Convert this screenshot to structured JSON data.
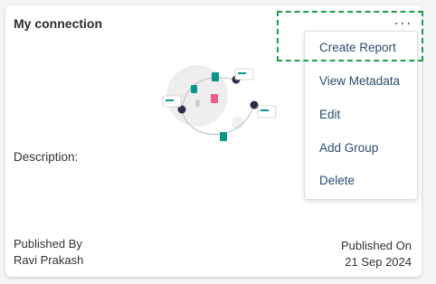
{
  "card": {
    "title": "My connection",
    "more_label": "...",
    "description_label": "Description:",
    "published_by_label": "Published By",
    "published_by_value": "Ravi Prakash",
    "published_on_label": "Published On",
    "published_on_value": "21 Sep 2024"
  },
  "menu": {
    "items": [
      "Create Report",
      "View Metadata",
      "Edit",
      "Add Group",
      "Delete"
    ]
  },
  "colors": {
    "menu_text": "#2b4c6e",
    "highlight": "#1ea04a",
    "accent_teal": "#0d9488",
    "accent_pink": "#ec5a8f",
    "node_dark": "#2d2f45"
  }
}
